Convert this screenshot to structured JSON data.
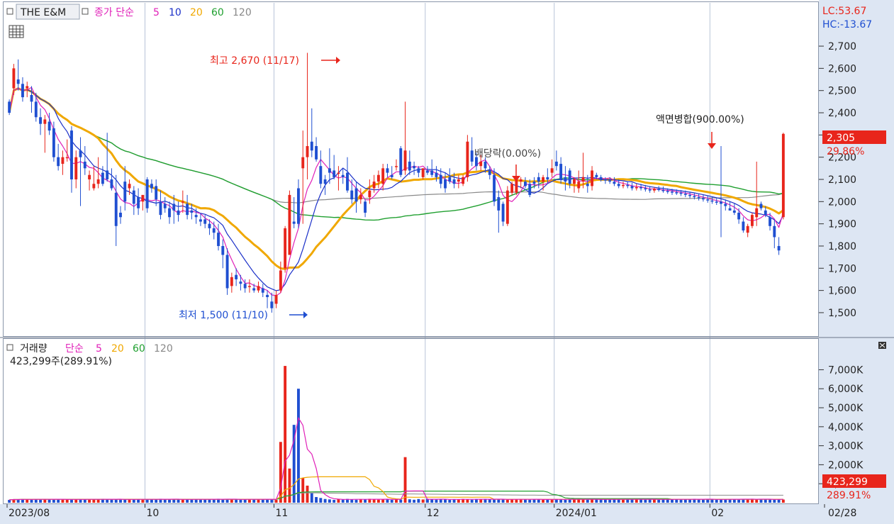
{
  "colors": {
    "up": "#e8251b",
    "down": "#1f4fd1",
    "ma5": "#e020b8",
    "ma10": "#1a2fc8",
    "ma20": "#f0a800",
    "ma60": "#20a030",
    "ma120": "#8a8a8a",
    "grid": "#b8c4d8",
    "axis_bg": "#dde6f3",
    "price_tag": "#e8251b"
  },
  "price_legend": {
    "name": "THE E&M",
    "ma_label": "종가 단순",
    "p5": "5",
    "p10": "10",
    "p20": "20",
    "p60": "60",
    "p120": "120"
  },
  "right_info": {
    "lc": "LC:53.67",
    "hc": "HC:-13.67"
  },
  "current": {
    "price": "2,305",
    "change": "29.86%",
    "volume": "423,299",
    "vol_change": "289.91%"
  },
  "volume_legend": {
    "name": "거래량",
    "ma_label": "단순",
    "p5": "5",
    "p20": "20",
    "p60": "60",
    "p120": "120",
    "summary": "423,299주(289.91%)"
  },
  "annotations": {
    "high": "최고 2,670 (11/17)",
    "low": "최저 1,500 (11/10)",
    "dividend": "배당락(0.00%)",
    "split": "액면병합(900.00%)"
  },
  "chart_data": [
    {
      "type": "candlestick",
      "title": "THE E&M",
      "ylim": [
        1420,
        2780
      ],
      "y_ticks": [
        "2,700",
        "2,600",
        "2,500",
        "2,400",
        "2,300",
        "2,200",
        "2,100",
        "2,000",
        "1,900",
        "1,800",
        "1,700",
        "1,600",
        "1,500"
      ],
      "y_tick_values": [
        2700,
        2600,
        2500,
        2400,
        2300,
        2200,
        2100,
        2000,
        1900,
        1800,
        1700,
        1600,
        1500
      ],
      "x_ticks": [
        "2023/08",
        "10",
        "11",
        "12",
        "2024/01",
        "02",
        "02/28"
      ],
      "x_tick_index": [
        0,
        31,
        60,
        94,
        123,
        158,
        193
      ],
      "candles": [
        [
          2450,
          2460,
          2390,
          2400
        ],
        [
          2510,
          2620,
          2480,
          2600
        ],
        [
          2550,
          2640,
          2500,
          2530
        ],
        [
          2530,
          2560,
          2450,
          2470
        ],
        [
          2510,
          2540,
          2470,
          2520
        ],
        [
          2480,
          2520,
          2400,
          2450
        ],
        [
          2450,
          2490,
          2360,
          2380
        ],
        [
          2380,
          2420,
          2300,
          2350
        ],
        [
          2350,
          2390,
          2220,
          2370
        ],
        [
          2360,
          2400,
          2300,
          2320
        ],
        [
          2330,
          2360,
          2180,
          2200
        ],
        [
          2200,
          2260,
          2140,
          2160
        ],
        [
          2170,
          2230,
          2120,
          2200
        ],
        [
          2200,
          2280,
          2180,
          2200
        ],
        [
          2320,
          2340,
          2040,
          2100
        ],
        [
          2100,
          2230,
          2060,
          2200
        ],
        [
          2230,
          2290,
          1980,
          2200
        ],
        [
          2180,
          2250,
          2120,
          2150
        ],
        [
          2100,
          2140,
          2050,
          2120
        ],
        [
          2060,
          2160,
          2050,
          2080
        ],
        [
          2080,
          2200,
          2060,
          2100
        ],
        [
          2130,
          2160,
          2070,
          2080
        ],
        [
          2140,
          2310,
          2090,
          2100
        ],
        [
          2100,
          2150,
          2050,
          2060
        ],
        [
          2040,
          2120,
          1800,
          1890
        ],
        [
          1950,
          1980,
          1900,
          1930
        ],
        [
          2090,
          2160,
          1960,
          2000
        ],
        [
          2060,
          2100,
          2030,
          2080
        ],
        [
          2050,
          2070,
          1940,
          1990
        ],
        [
          2020,
          2060,
          1940,
          1970
        ],
        [
          2000,
          2030,
          1960,
          2030
        ],
        [
          2100,
          2110,
          1950,
          1970
        ],
        [
          2080,
          2100,
          2040,
          2060
        ],
        [
          2070,
          2100,
          1980,
          2010
        ],
        [
          2000,
          2050,
          1920,
          1940
        ],
        [
          1990,
          2020,
          1950,
          1970
        ],
        [
          1970,
          2000,
          1900,
          1930
        ],
        [
          1990,
          2030,
          1900,
          1960
        ],
        [
          1960,
          2000,
          1910,
          1940
        ],
        [
          2000,
          2050,
          1950,
          2000
        ],
        [
          1990,
          2030,
          1920,
          1940
        ],
        [
          1960,
          1990,
          1920,
          1950
        ],
        [
          1940,
          1970,
          1900,
          1930
        ],
        [
          1920,
          1950,
          1890,
          1910
        ],
        [
          1920,
          1940,
          1880,
          1900
        ],
        [
          1900,
          1920,
          1850,
          1880
        ],
        [
          1880,
          1910,
          1830,
          1860
        ],
        [
          1860,
          1900,
          1780,
          1800
        ],
        [
          1800,
          1830,
          1700,
          1760
        ],
        [
          1760,
          1790,
          1580,
          1610
        ],
        [
          1620,
          1680,
          1590,
          1660
        ],
        [
          1670,
          1700,
          1620,
          1650
        ],
        [
          1640,
          1670,
          1600,
          1630
        ],
        [
          1630,
          1650,
          1590,
          1610
        ],
        [
          1620,
          1650,
          1590,
          1620
        ],
        [
          1610,
          1630,
          1590,
          1600
        ],
        [
          1600,
          1640,
          1590,
          1620
        ],
        [
          1610,
          1630,
          1570,
          1590
        ],
        [
          1580,
          1600,
          1520,
          1570
        ],
        [
          1550,
          1590,
          1500,
          1520
        ],
        [
          1540,
          1600,
          1520,
          1580
        ],
        [
          1600,
          1730,
          1590,
          1690
        ],
        [
          1700,
          1890,
          1680,
          1880
        ],
        [
          1760,
          2050,
          1760,
          2030
        ],
        [
          1910,
          2020,
          1880,
          1900
        ],
        [
          2060,
          2100,
          1880,
          1900
        ],
        [
          2150,
          2320,
          1900,
          2200
        ],
        [
          2200,
          2670,
          2100,
          2250
        ],
        [
          2270,
          2420,
          2200,
          2230
        ],
        [
          2250,
          2290,
          2180,
          2190
        ],
        [
          2160,
          2230,
          2060,
          2080
        ],
        [
          2100,
          2120,
          2030,
          2080
        ],
        [
          2150,
          2240,
          2080,
          2130
        ],
        [
          2140,
          2210,
          2100,
          2110
        ],
        [
          2130,
          2160,
          2050,
          2130
        ],
        [
          2120,
          2150,
          2080,
          2110
        ],
        [
          2130,
          2200,
          2040,
          2050
        ],
        [
          2050,
          2100,
          1990,
          2010
        ],
        [
          2060,
          2090,
          1950,
          2000
        ],
        [
          2010,
          2060,
          1990,
          2030
        ],
        [
          2000,
          2010,
          1930,
          1950
        ],
        [
          2020,
          2100,
          1990,
          2050
        ],
        [
          2060,
          2120,
          2040,
          2090
        ],
        [
          2090,
          2140,
          2060,
          2120
        ],
        [
          2080,
          2170,
          2050,
          2150
        ],
        [
          2150,
          2170,
          2110,
          2130
        ],
        [
          2120,
          2160,
          2100,
          2110
        ],
        [
          2160,
          2190,
          2140,
          2160
        ],
        [
          2240,
          2250,
          2110,
          2120
        ],
        [
          2140,
          2450,
          2120,
          2230
        ],
        [
          2180,
          2230,
          2120,
          2140
        ],
        [
          2160,
          2180,
          2120,
          2150
        ],
        [
          2150,
          2160,
          2110,
          2130
        ],
        [
          2110,
          2150,
          2100,
          2150
        ],
        [
          2140,
          2160,
          2120,
          2130
        ],
        [
          2140,
          2190,
          2110,
          2120
        ],
        [
          2130,
          2160,
          2090,
          2110
        ],
        [
          2120,
          2150,
          2060,
          2080
        ],
        [
          2100,
          2130,
          2040,
          2060
        ],
        [
          2110,
          2150,
          2080,
          2090
        ],
        [
          2100,
          2130,
          2060,
          2080
        ],
        [
          2090,
          2120,
          2060,
          2100
        ],
        [
          2080,
          2120,
          2070,
          2110
        ],
        [
          2110,
          2300,
          2090,
          2270
        ],
        [
          2230,
          2290,
          2160,
          2180
        ],
        [
          2200,
          2220,
          2140,
          2160
        ],
        [
          2160,
          2210,
          2140,
          2180
        ],
        [
          2180,
          2200,
          2130,
          2150
        ],
        [
          2140,
          2160,
          2100,
          2120
        ],
        [
          2120,
          2150,
          1980,
          2000
        ],
        [
          2020,
          2050,
          1860,
          1960
        ],
        [
          1990,
          2000,
          1890,
          1910
        ],
        [
          1900,
          2070,
          1890,
          2050
        ],
        [
          2040,
          2090,
          2030,
          2080
        ],
        [
          2040,
          2110,
          2030,
          2100
        ],
        [
          2090,
          2110,
          2060,
          2100
        ],
        [
          2090,
          2110,
          2060,
          2070
        ],
        [
          2080,
          2100,
          2020,
          2030
        ],
        [
          2090,
          2110,
          2060,
          2080
        ],
        [
          2110,
          2130,
          2060,
          2090
        ],
        [
          2090,
          2120,
          2050,
          2110
        ],
        [
          2110,
          2150,
          2080,
          2100
        ],
        [
          2130,
          2190,
          2110,
          2150
        ],
        [
          2180,
          2230,
          2140,
          2160
        ],
        [
          2170,
          2200,
          2080,
          2100
        ],
        [
          2110,
          2160,
          2050,
          2090
        ],
        [
          2140,
          2150,
          2060,
          2080
        ],
        [
          2080,
          2110,
          2040,
          2100
        ],
        [
          2060,
          2140,
          2040,
          2090
        ],
        [
          2090,
          2220,
          2060,
          2110
        ],
        [
          2080,
          2120,
          2040,
          2070
        ],
        [
          2070,
          2160,
          2050,
          2140
        ],
        [
          2120,
          2130,
          2100,
          2110
        ],
        [
          2110,
          2120,
          2090,
          2100
        ],
        [
          2100,
          2110,
          2080,
          2095
        ],
        [
          2095,
          2110,
          2080,
          2090
        ],
        [
          2090,
          2110,
          2070,
          2080
        ],
        [
          2080,
          2100,
          2060,
          2070
        ],
        [
          2070,
          2090,
          2060,
          2075
        ],
        [
          2075,
          2090,
          2060,
          2070
        ],
        [
          2070,
          2085,
          2050,
          2060
        ],
        [
          2060,
          2080,
          2050,
          2065
        ],
        [
          2065,
          2080,
          2050,
          2060
        ],
        [
          2060,
          2075,
          2045,
          2055
        ],
        [
          2055,
          2070,
          2040,
          2050
        ],
        [
          2050,
          2065,
          2040,
          2058
        ],
        [
          2058,
          2070,
          2045,
          2052
        ],
        [
          2052,
          2068,
          2040,
          2048
        ],
        [
          2048,
          2060,
          2035,
          2045
        ],
        [
          2045,
          2058,
          2030,
          2042
        ],
        [
          2042,
          2055,
          2030,
          2040
        ],
        [
          2040,
          2052,
          2025,
          2035
        ],
        [
          2035,
          2050,
          2020,
          2030
        ],
        [
          2030,
          2045,
          2015,
          2025
        ],
        [
          2025,
          2040,
          2010,
          2020
        ],
        [
          2020,
          2035,
          2005,
          2015
        ],
        [
          2015,
          2030,
          2000,
          2010
        ],
        [
          2010,
          2025,
          1995,
          2005
        ],
        [
          2005,
          2020,
          1990,
          2000
        ],
        [
          2000,
          2015,
          1985,
          1995
        ],
        [
          2000,
          2250,
          1840,
          1990
        ],
        [
          1990,
          2010,
          1960,
          1980
        ],
        [
          1970,
          2000,
          1960,
          1960
        ],
        [
          1960,
          1990,
          1940,
          1950
        ],
        [
          1950,
          1970,
          1900,
          1920
        ],
        [
          1910,
          1930,
          1860,
          1870
        ],
        [
          1860,
          1900,
          1840,
          1890
        ],
        [
          1890,
          1950,
          1880,
          1940
        ],
        [
          1930,
          2180,
          1890,
          1970
        ],
        [
          1990,
          2000,
          1960,
          1970
        ],
        [
          1960,
          1980,
          1930,
          1940
        ],
        [
          1930,
          1950,
          1870,
          1890
        ],
        [
          1890,
          1920,
          1790,
          1840
        ],
        [
          1800,
          1840,
          1760,
          1780
        ],
        [
          1930,
          2310,
          1920,
          2305
        ]
      ]
    },
    {
      "type": "bar",
      "title": "거래량",
      "ylim": [
        0,
        7800
      ],
      "y_ticks": [
        "7,000K",
        "6,000K",
        "5,000K",
        "4,000K",
        "3,000K",
        "2,000K",
        "1,000K"
      ],
      "y_tick_values": [
        7000,
        6000,
        5000,
        4000,
        3000,
        2000,
        1000
      ],
      "unit": "K"
    }
  ]
}
